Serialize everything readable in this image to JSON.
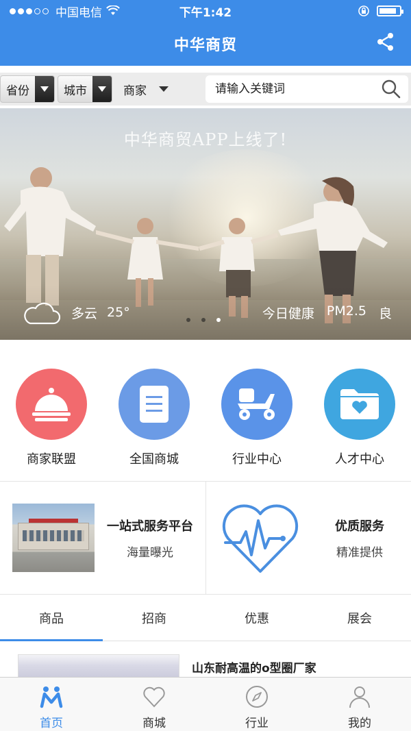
{
  "status_bar": {
    "carrier": "中国电信",
    "time": "下午1:42",
    "battery_level": 0.85
  },
  "nav": {
    "title": "中华商贸"
  },
  "filter": {
    "province_label": "省份",
    "city_label": "城市",
    "merchant_label": "商家",
    "search_placeholder": "请输入关键词"
  },
  "banner": {
    "headline": "中华商贸APP上线了!",
    "weather_condition": "多云",
    "temperature": "25°",
    "health_label": "今日健康",
    "pm_label": "PM2.5",
    "air_quality": "良",
    "page_count": 3,
    "active_page": 3
  },
  "grid": [
    {
      "label": "商家联盟",
      "color": "#f26a6e",
      "icon": "cloche-icon"
    },
    {
      "label": "全国商城",
      "color": "#6b9be6",
      "icon": "document-icon"
    },
    {
      "label": "行业中心",
      "color": "#5a93e8",
      "icon": "scooter-icon"
    },
    {
      "label": "人才中心",
      "color": "#3fa6e0",
      "icon": "heart-folder-icon"
    }
  ],
  "promo": {
    "left": {
      "title": "一站式服务平台",
      "subtitle": "海量曝光"
    },
    "right": {
      "title": "优质服务",
      "subtitle": "精准提供"
    }
  },
  "tabs": [
    "商品",
    "招商",
    "优惠",
    "展会"
  ],
  "active_tab": "商品",
  "product": {
    "name": "山东耐高温的o型圈厂家"
  },
  "tabbar": [
    {
      "label": "首页",
      "icon": "home-people-icon",
      "active": true
    },
    {
      "label": "商城",
      "icon": "heart-icon",
      "active": false
    },
    {
      "label": "行业",
      "icon": "compass-icon",
      "active": false
    },
    {
      "label": "我的",
      "icon": "user-icon",
      "active": false
    }
  ],
  "colors": {
    "primary": "#3d8ce8"
  }
}
